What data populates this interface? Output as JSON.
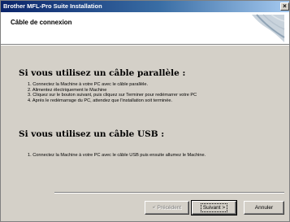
{
  "window": {
    "title": "Brother MFL-Pro Suite Installation",
    "close_glyph": "×"
  },
  "header": {
    "title": "Câble de connexion",
    "graphic_icon": "wizard-corner-graphic"
  },
  "sections": [
    {
      "title": "Si vous utilisez un câble parallèle :",
      "steps": [
        "1. Connectez la Machine à votre PC avec le câble parallèle.",
        "2. Alimentez électriquement le Machine",
        "3. Cliquez sur le bouton suivant, puis cliquez sur Terminer pour redémarrer votre PC",
        "4. Après le redémarrage du PC, attendez que l'installation soit terminée."
      ]
    },
    {
      "title": "Si vous utilisez un câble USB :",
      "steps": [
        "1. Connectez la Machine à votre PC avec le câble USB puis ensuite allumez le Machine."
      ]
    }
  ],
  "buttons": {
    "back": "< Précédent",
    "next": "Suivant >",
    "cancel": "Annuler"
  },
  "colors": {
    "titlebar_start": "#0a246a",
    "titlebar_end": "#a6caf0",
    "dialog_face": "#d4d0c8"
  }
}
